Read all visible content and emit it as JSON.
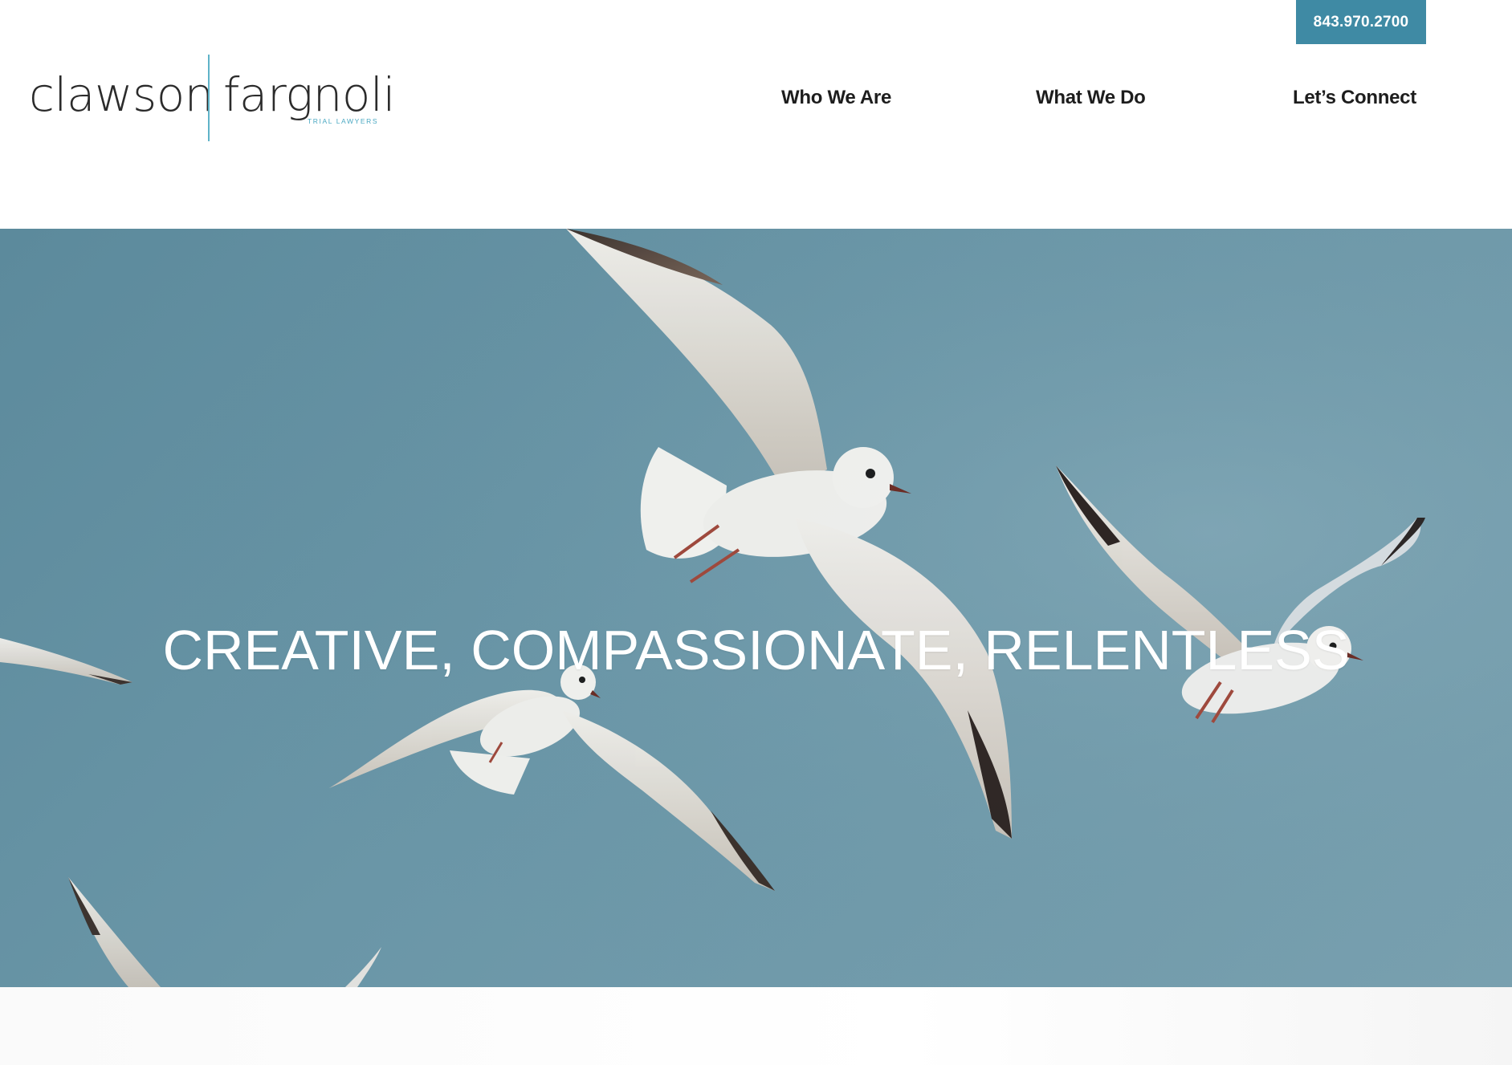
{
  "header": {
    "phone": "843.970.2700",
    "logo": {
      "left": "clawson",
      "right": "fargnoli",
      "tagline": "TRIAL LAWYERS",
      "divider_color": "#5fb3c8"
    },
    "nav": [
      {
        "label": "Who We Are"
      },
      {
        "label": "What We Do"
      },
      {
        "label": "Let’s Connect"
      }
    ]
  },
  "hero": {
    "title": "CREATIVE, COMPASSIONATE, RELENTLESS",
    "image": "seagulls-flying-sky",
    "sky_color": "#6a96a7"
  },
  "colors": {
    "accent": "#3f8aa4",
    "text": "#1d1d1d",
    "white": "#ffffff"
  }
}
